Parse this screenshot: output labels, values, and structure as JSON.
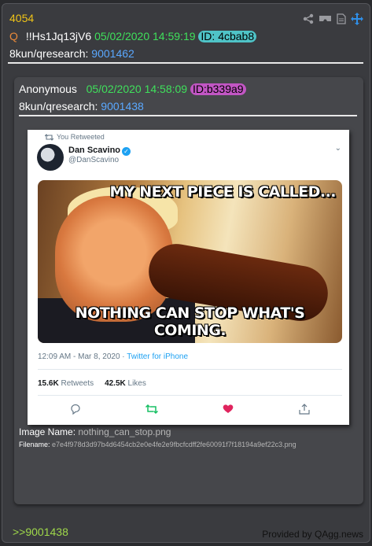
{
  "post": {
    "number": "4054",
    "q_label": "Q",
    "tripcode": "!!Hs1Jq13jV6",
    "datetime": "05/02/2020 14:59:19",
    "id_label": "ID: 4cbab8",
    "id_color": "#4fc3c7",
    "board": "8kun/qresearch:",
    "post_no": "9001462"
  },
  "toolbar_icons": [
    "share-icon",
    "vr-glasses-icon",
    "document-icon",
    "move-arrows-icon"
  ],
  "quote": {
    "author": "Anonymous",
    "datetime": "05/02/2020 14:58:09",
    "id_label": "ID:b339a9",
    "id_color": "#c256c4",
    "board": "8kun/qresearch:",
    "post_no": "9001438",
    "image_name_label": "Image Name:",
    "image_name": "nothing_can_stop.png",
    "filename_label": "Filename:",
    "filename": "e7e4f978d3d97b4d6454cb2e0e4fe2e9fbcfcdff2fe60091f7f18194a9ef22c3.png"
  },
  "tweet": {
    "retweeted": "You Retweeted",
    "display_name": "Dan Scavino",
    "handle": "@DanScavino",
    "meme_top": "MY NEXT PIECE IS CALLED...",
    "meme_bottom": "NOTHING CAN STOP WHAT'S COMING.",
    "timestamp": "12:09 AM - Mar 8, 2020 · ",
    "source": "Twitter for iPhone",
    "retweets_count": "15.6K",
    "retweets_label": " Retweets",
    "likes_count": "42.5K",
    "likes_label": " Likes",
    "colors": {
      "twitter_blue": "#1da1f2",
      "retweet_green": "#17bf63",
      "like_red": "#e0245e"
    }
  },
  "footer": {
    "reply_link": ">>9001438",
    "provided_by": "Provided by QAgg.news"
  }
}
